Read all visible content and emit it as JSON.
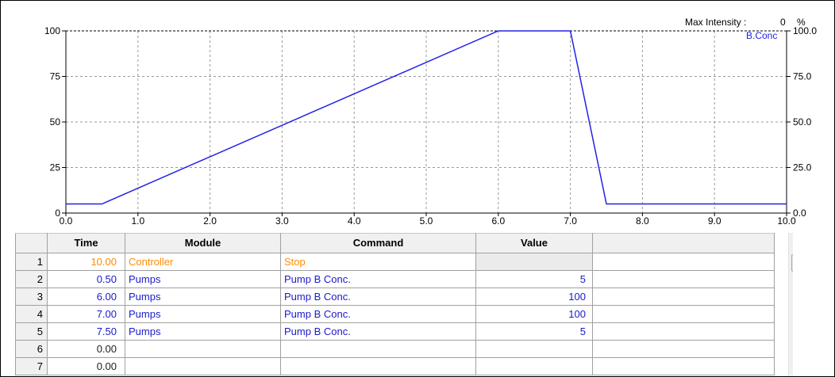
{
  "chart_data": {
    "type": "line",
    "x": [
      0.0,
      0.5,
      6.0,
      7.0,
      7.5,
      10.0
    ],
    "series": [
      {
        "name": "B.Conc",
        "values": [
          5,
          5,
          100,
          100,
          5,
          5
        ],
        "color": "#2222e6"
      }
    ],
    "xlim": [
      0,
      10
    ],
    "ylim": [
      0,
      100
    ],
    "x_ticks": [
      "0.0",
      "1.0",
      "2.0",
      "3.0",
      "4.0",
      "5.0",
      "6.0",
      "7.0",
      "8.0",
      "9.0",
      "10.0"
    ],
    "y_ticks_left": [
      "0",
      "25",
      "50",
      "75",
      "100"
    ],
    "y_ticks_right": [
      "0.0",
      "25.0",
      "50.0",
      "75.0",
      "100.0"
    ],
    "grid": true,
    "legend_position": "top-right"
  },
  "header": {
    "max_intensity_label": "Max Intensity :",
    "max_intensity_value": "0",
    "unit": "%"
  },
  "colors": {
    "controller_row": "#ff8c00",
    "pump_rows": "#1a1acc",
    "series_line": "#2222e6"
  },
  "table": {
    "columns": [
      "",
      "Time",
      "Module",
      "Command",
      "Value",
      ""
    ],
    "rows": [
      {
        "num": "1",
        "time": "10.00",
        "module": "Controller",
        "command": "Stop",
        "value": ""
      },
      {
        "num": "2",
        "time": "0.50",
        "module": "Pumps",
        "command": "Pump B Conc.",
        "value": "5"
      },
      {
        "num": "3",
        "time": "6.00",
        "module": "Pumps",
        "command": "Pump B Conc.",
        "value": "100"
      },
      {
        "num": "4",
        "time": "7.00",
        "module": "Pumps",
        "command": "Pump B Conc.",
        "value": "100"
      },
      {
        "num": "5",
        "time": "7.50",
        "module": "Pumps",
        "command": "Pump B Conc.",
        "value": "5"
      },
      {
        "num": "6",
        "time": "0.00",
        "module": "",
        "command": "",
        "value": ""
      },
      {
        "num": "7",
        "time": "0.00",
        "module": "",
        "command": "",
        "value": ""
      }
    ]
  },
  "scrollbar": {
    "up_icon": "scroll-up-arrow-icon"
  }
}
